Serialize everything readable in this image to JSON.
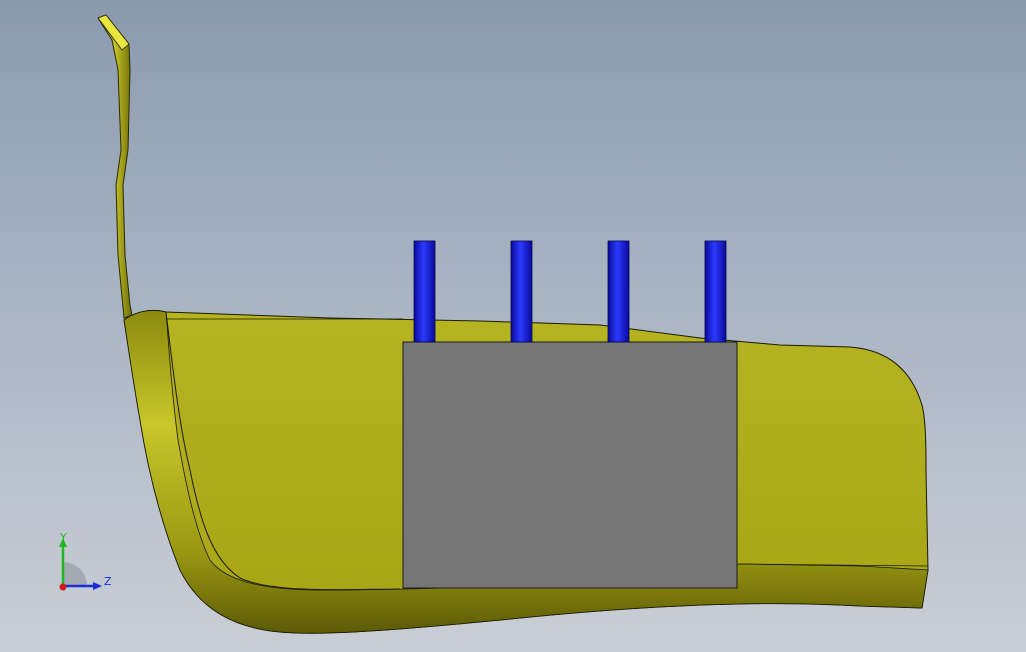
{
  "viewport": {
    "background_top": "#8a9aae",
    "background_bottom": "#c9ced6"
  },
  "model": {
    "hull_color": "#b0ae1e",
    "hull_shadow_color": "#7a780a",
    "hull_highlight_color": "#e6e33a",
    "block_color": "#767676",
    "pin_color": "#1a1ad0",
    "pin_count": 4
  },
  "triad": {
    "y_label": "Y",
    "z_label": "Z",
    "y_color": "#1fb81f",
    "z_color": "#1a2cd6",
    "x_color": "#d21c1c"
  }
}
